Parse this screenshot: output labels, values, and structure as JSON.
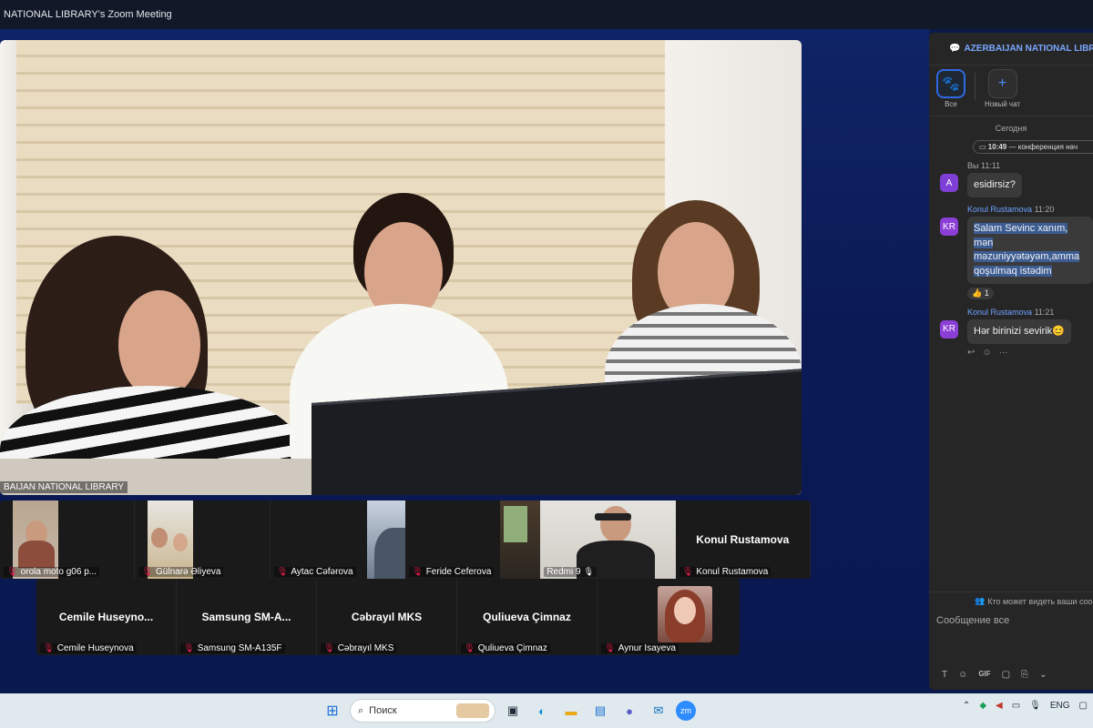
{
  "window": {
    "title": "NATIONAL LIBRARY's Zoom Meeting"
  },
  "main_video": {
    "label": "BAIJAN NATIONAL LIBRARY"
  },
  "thumbnails_row1": [
    {
      "label": "orola moto g06 p...",
      "muted": true,
      "video": true
    },
    {
      "label": "Gülnarə Əliyeva",
      "muted": true,
      "video": true
    },
    {
      "label": "Aytac Cəfərova",
      "muted": true,
      "video": true
    },
    {
      "label": "Feride Ceferova",
      "muted": true,
      "video": true
    },
    {
      "label": "Redmi 9",
      "muted": false,
      "video": true
    },
    {
      "label": "Konul Rustamova",
      "muted": true,
      "video": false,
      "display": "Konul Rustamova"
    }
  ],
  "thumbnails_row2": [
    {
      "label": "Cemile Huseynova",
      "muted": true,
      "display": "Cemile  Huseyno..."
    },
    {
      "label": "Samsung SM-A135F",
      "muted": true,
      "display": "Samsung  SM-A..."
    },
    {
      "label": "Cəbrayıl MKS",
      "muted": true,
      "display": "Cəbrayıl MKS"
    },
    {
      "label": "Quliueva Çimnaz",
      "muted": true,
      "display": "Quliueva Çimnaz"
    },
    {
      "label": "Aynur İsayeva",
      "muted": true,
      "video": true
    }
  ],
  "chat": {
    "title": "AZERBAIJAN NATIONAL LIBRA",
    "tabs": [
      {
        "label": "Все",
        "icon": "people-icon"
      },
      {
        "label": "Новый чат",
        "icon": "plus-icon"
      }
    ],
    "day": "Сегодня",
    "system_time": "10:49",
    "system_text": "— конференция нач",
    "messages": [
      {
        "avatar": "A",
        "sender": "Вы",
        "time": "11:11",
        "text": "esidirsiz?",
        "avatar_color": "#7e3fd6"
      },
      {
        "avatar": "KR",
        "sender": "Konul Rustamova",
        "time": "11:20",
        "lines": [
          "Salam Sevinc xanım, mən",
          "məzuniyyətəyəm,amma",
          "qoşulmaq istədim"
        ],
        "reaction": "👍 1",
        "avatar_color": "#8b3fd6"
      },
      {
        "avatar": "KR",
        "sender": "Konul Rustamova",
        "time": "11:21",
        "text": "Hər birinizi sevirik😊",
        "avatar_color": "#8b3fd6"
      }
    ],
    "who_sees": "Кто может видеть ваши соо",
    "input_placeholder": "Сообщение все",
    "toolbar": [
      "T",
      "☺",
      "GIF",
      "▢",
      "⎘",
      "⌄"
    ]
  },
  "taskbar": {
    "search_label": "Поиск",
    "language": "ENG"
  }
}
